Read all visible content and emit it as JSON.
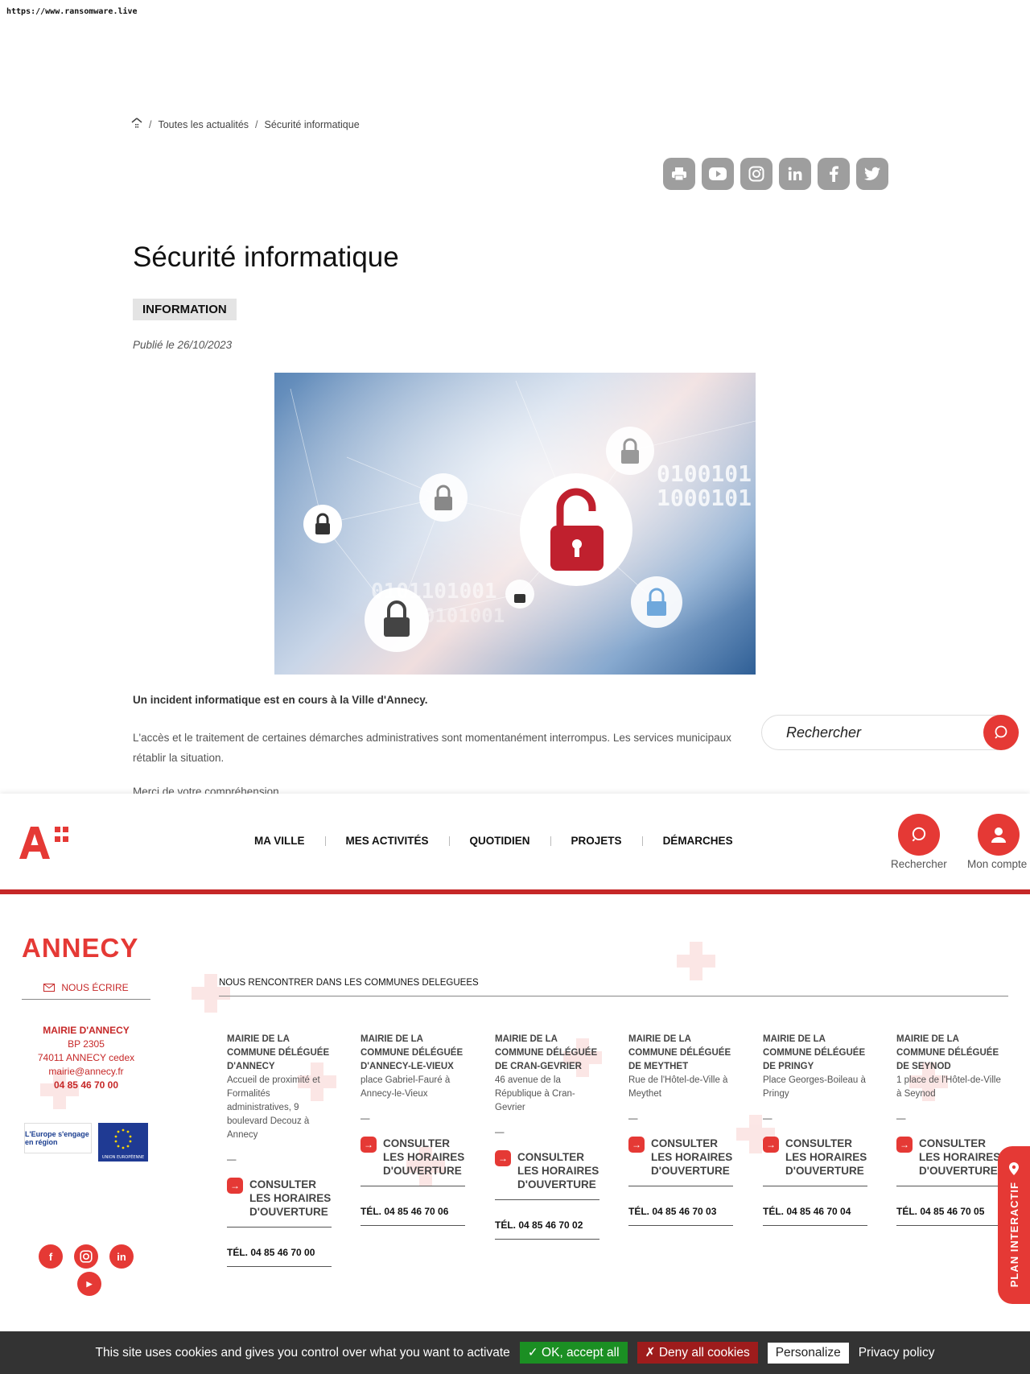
{
  "browser": {
    "url": "https://www.ransomware.live"
  },
  "breadcrumb": {
    "home_icon": "home-icon",
    "items": [
      "Toutes les actualités",
      "Sécurité informatique"
    ]
  },
  "share": {
    "buttons": [
      "print-icon",
      "youtube-icon",
      "instagram-icon",
      "linkedin-icon",
      "facebook-icon",
      "twitter-icon"
    ]
  },
  "article": {
    "title": "Sécurité informatique",
    "tag": "INFORMATION",
    "published": "Publié le 26/10/2023",
    "lead": "Un incident informatique est en cours à la Ville d'Annecy.",
    "body": "L'accès et le traitement de certaines démarches administratives sont momentanément interrompus. Les services municipaux",
    "body2": "rétablir la situation.",
    "thanks": "Merci de votre compréhension"
  },
  "search": {
    "placeholder": "Rechercher"
  },
  "nav": {
    "items": [
      "MA VILLE",
      "MES ACTIVITÉS",
      "QUOTIDIEN",
      "PROJETS",
      "DÉMARCHES"
    ],
    "search_label": "Rechercher",
    "account_label": "Mon compte"
  },
  "footer": {
    "brand": "ANNECY",
    "write_label": "NOUS ÉCRIRE",
    "contact": {
      "name": "MAIRIE D'ANNECY",
      "bp": "BP 2305",
      "city": "74011 ANNECY cedex",
      "email": "mairie@annecy.fr",
      "phone": "04 85 46 70 00"
    },
    "badge_region": "L'Europe s'engage en région",
    "badge_eu": "UNION EUROPÉENNE",
    "communes_heading": "NOUS RENCONTRER DANS LES COMMUNES DELEGUEES",
    "communes": [
      {
        "title": "MAIRIE DE LA COMMUNE DÉLÉGUÉE D'ANNECY",
        "address": "Accueil de proximité et Formalités administratives, 9 boulevard Decouz à Annecy",
        "cta": "CONSULTER LES HORAIRES D'OUVERTURE",
        "tel": "TÉL. 04 85 46 70 00"
      },
      {
        "title": "MAIRIE DE LA COMMUNE DÉLÉGUÉE D'ANNECY-LE-VIEUX",
        "address": "place Gabriel-Fauré à Annecy-le-Vieux",
        "cta": "CONSULTER LES HORAIRES D'OUVERTURE",
        "tel": "TÉL. 04 85 46 70 06"
      },
      {
        "title": "MAIRIE DE LA COMMUNE DÉLÉGUÉE DE CRAN-GEVRIER",
        "address": "46 avenue de la République à Cran-Gevrier",
        "cta": "CONSULTER LES HORAIRES D'OUVERTURE",
        "tel": "TÉL. 04 85 46 70 02"
      },
      {
        "title": "MAIRIE DE LA COMMUNE DÉLÉGUÉE DE MEYTHET",
        "address": "Rue de l'Hôtel-de-Ville à Meythet",
        "cta": "CONSULTER LES HORAIRES D'OUVERTURE",
        "tel": "TÉL. 04 85 46 70 03"
      },
      {
        "title": "MAIRIE DE LA COMMUNE DÉLÉGUÉE DE PRINGY",
        "address": "Place Georges-Boileau à Pringy",
        "cta": "CONSULTER LES HORAIRES D'OUVERTURE",
        "tel": "TÉL. 04 85 46 70 04"
      },
      {
        "title": "MAIRIE DE LA COMMUNE DÉLÉGUÉE DE SEYNOD",
        "address": "1 place de l'Hôtel-de-Ville à Seynod",
        "cta": "CONSULTER LES HORAIRES D'OUVERTURE",
        "tel": "TÉL. 04 85 46 70 05"
      }
    ],
    "social": [
      "facebook-icon",
      "instagram-icon",
      "linkedin-icon",
      "youtube-icon"
    ],
    "dash": "—"
  },
  "plan": {
    "label": "PLAN INTERACTIF"
  },
  "cookie": {
    "text": "This site uses cookies and gives you control over what you want to activate",
    "accept": "✓ OK, accept all",
    "deny": "✗ Deny all cookies",
    "personalize": "Personalize",
    "policy": "Privacy policy"
  },
  "colors": {
    "accent": "#e53935",
    "dark_red": "#c62828",
    "cookie_bg": "#333333",
    "accept_green": "#1b8f23"
  }
}
